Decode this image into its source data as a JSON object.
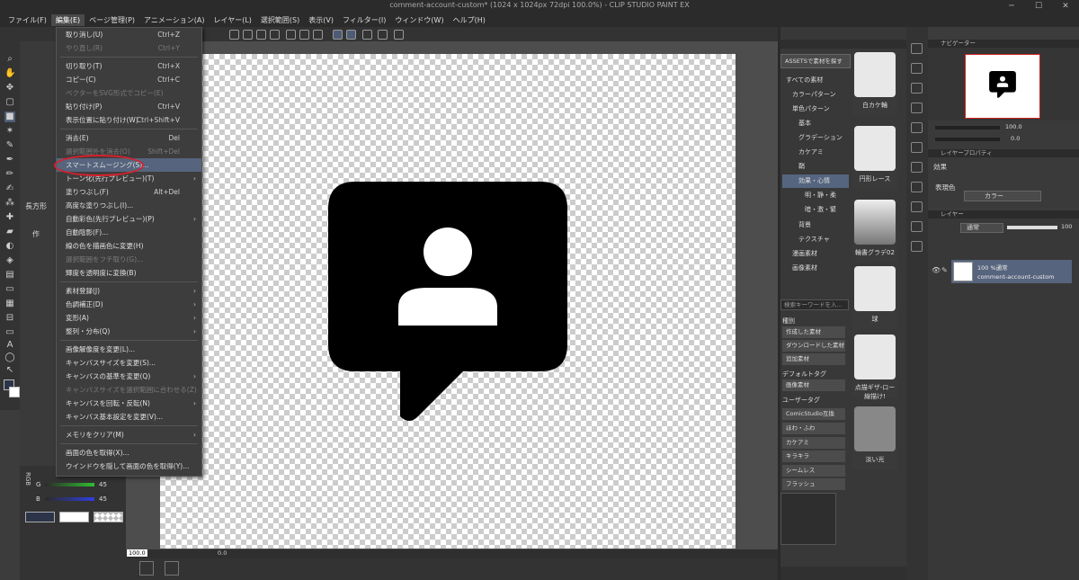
{
  "window": {
    "title": "comment-account-custom* (1024 x 1024px 72dpi 100.0%) - CLIP STUDIO PAINT EX",
    "minimize": "─",
    "maximize": "☐",
    "close": "✕"
  },
  "menubar": [
    "ファイル(F)",
    "編集(E)",
    "ページ管理(P)",
    "アニメーション(A)",
    "レイヤー(L)",
    "選択範囲(S)",
    "表示(V)",
    "フィルター(I)",
    "ウィンドウ(W)",
    "ヘルプ(H)"
  ],
  "edit_menu": [
    {
      "label": "取り消し(U)",
      "shortcut": "Ctrl+Z",
      "disabled": false
    },
    {
      "label": "やり直し(R)",
      "shortcut": "Ctrl+Y",
      "disabled": true
    },
    {
      "sep": true
    },
    {
      "label": "切り取り(T)",
      "shortcut": "Ctrl+X",
      "disabled": false
    },
    {
      "label": "コピー(C)",
      "shortcut": "Ctrl+C",
      "disabled": false
    },
    {
      "label": "ベクターをSVG形式でコピー(E)",
      "shortcut": "",
      "disabled": true
    },
    {
      "label": "貼り付け(P)",
      "shortcut": "Ctrl+V",
      "disabled": false
    },
    {
      "label": "表示位置に貼り付け(W)",
      "shortcut": "Ctrl+Shift+V",
      "disabled": false
    },
    {
      "sep": true
    },
    {
      "label": "消去(E)",
      "shortcut": "Del",
      "disabled": false
    },
    {
      "label": "選択範囲外を消去(O)",
      "shortcut": "Shift+Del",
      "disabled": true
    },
    {
      "label": "スマートスムージング(S)...",
      "shortcut": "",
      "disabled": false,
      "highlight": true
    },
    {
      "label": "トーン化(先行プレビュー)(T)",
      "shortcut": "",
      "disabled": false,
      "arrow": true
    },
    {
      "label": "塗りつぶし(F)",
      "shortcut": "Alt+Del",
      "disabled": false
    },
    {
      "label": "高度な塗りつぶし(I)...",
      "shortcut": "",
      "disabled": false
    },
    {
      "label": "自動彩色(先行プレビュー)(P)",
      "shortcut": "",
      "disabled": false,
      "arrow": true
    },
    {
      "label": "自動陰影(F)...",
      "shortcut": "",
      "disabled": false
    },
    {
      "label": "線の色を描画色に変更(H)",
      "shortcut": "",
      "disabled": false
    },
    {
      "label": "選択範囲をフチ取り(G)...",
      "shortcut": "",
      "disabled": true
    },
    {
      "label": "輝度を透明度に変換(B)",
      "shortcut": "",
      "disabled": false
    },
    {
      "sep": true
    },
    {
      "label": "素材登録(J)",
      "shortcut": "",
      "disabled": false,
      "arrow": true
    },
    {
      "label": "色調補正(D)",
      "shortcut": "",
      "disabled": false,
      "arrow": true
    },
    {
      "label": "変形(A)",
      "shortcut": "",
      "disabled": false,
      "arrow": true
    },
    {
      "label": "整列・分布(Q)",
      "shortcut": "",
      "disabled": false,
      "arrow": true
    },
    {
      "sep": true
    },
    {
      "label": "画像解像度を変更(L)...",
      "shortcut": "",
      "disabled": false
    },
    {
      "label": "キャンバスサイズを変更(S)...",
      "shortcut": "",
      "disabled": false
    },
    {
      "label": "キャンバスの基準を変更(Q)",
      "shortcut": "",
      "disabled": false,
      "arrow": true
    },
    {
      "label": "キャンバスサイズを選択範囲に合わせる(Z)",
      "shortcut": "",
      "disabled": true
    },
    {
      "label": "キャンバスを回転・反転(N)",
      "shortcut": "",
      "disabled": false,
      "arrow": true
    },
    {
      "label": "キャンバス基本設定を変更(V)...",
      "shortcut": "",
      "disabled": false
    },
    {
      "sep": true
    },
    {
      "label": "メモリをクリア(M)",
      "shortcut": "",
      "disabled": false,
      "arrow": true
    },
    {
      "sep": true
    },
    {
      "label": "画面の色を取得(X)...",
      "shortcut": "",
      "disabled": false
    },
    {
      "label": "ウインドウを隠して画面の色を取得(Y)...",
      "shortcut": "",
      "disabled": false
    }
  ],
  "material": {
    "assets_button": "ASSETSで素材を探す",
    "tree": [
      "すべての素材",
      "カラーパターン",
      "単色パターン",
      "基本",
      "グラデーション",
      "カケアミ",
      "鞘",
      "効果・心情",
      "明・静・柔",
      "暗・激・緊",
      "背景",
      "テクスチャ",
      "漫画素材",
      "画像素材"
    ],
    "thumbs": [
      "白カケ輪",
      "円形レース",
      "輪書グラデ02",
      "球",
      "点描ギザ-ロー線描け!",
      "淡い光"
    ],
    "search_placeholder": "検索キーワードを入...",
    "type_header": "種別",
    "type_buttons": [
      "作成した素材",
      "ダウンロードした素材",
      "追加素材"
    ],
    "default_tag_header": "デフォルトタグ",
    "default_tag": "画像素材",
    "user_tag_header": "ユーザータグ",
    "user_tags": [
      "ComicStudio互換",
      "ほわ・ふわ",
      "カケアミ",
      "キラキラ",
      "シームレス",
      "フラッシュ"
    ]
  },
  "navigator": {
    "header": "ナビゲーター",
    "zoom": "100.0",
    "rotation": "0.0"
  },
  "layer_property": {
    "header": "レイヤープロパティ",
    "effect": "効果",
    "expression_label": "表現色",
    "expression_value": "カラー"
  },
  "layers": {
    "header": "レイヤー",
    "blend": "通常",
    "opacity": "100",
    "layer_info": "100 %通常",
    "layer_name": "comment-account-custom"
  },
  "canvas_status": {
    "zoom": "100.0",
    "angle": "0.0"
  },
  "color": {
    "g_label": "G",
    "g_value": "45",
    "b_label": "B",
    "b_value": "45",
    "mode": "RGB"
  },
  "subtool": {
    "label1": "長方形",
    "label2": "作"
  },
  "icons": [
    "comment-account-icon"
  ]
}
